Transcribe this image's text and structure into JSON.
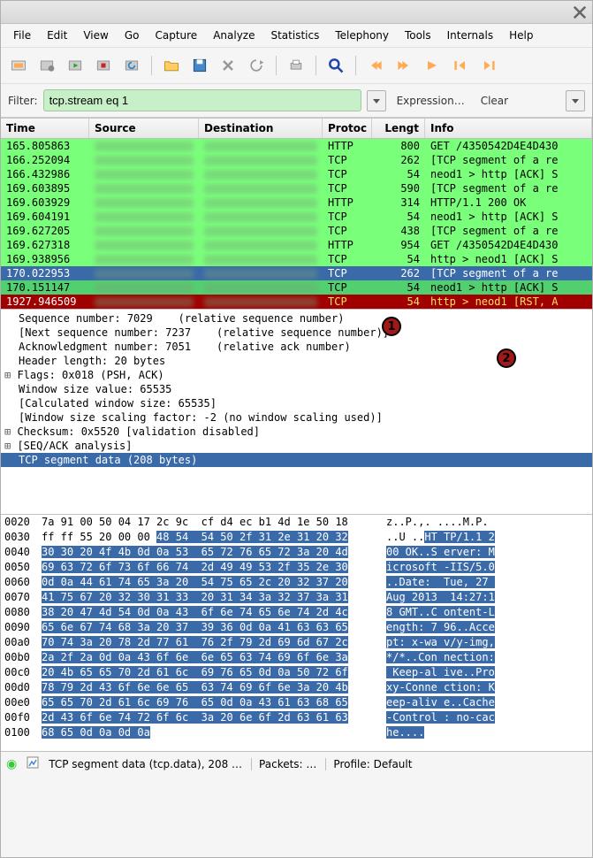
{
  "menus": [
    "File",
    "Edit",
    "View",
    "Go",
    "Capture",
    "Analyze",
    "Statistics",
    "Telephony",
    "Tools",
    "Internals",
    "Help"
  ],
  "filter": {
    "label": "Filter:",
    "value": "tcp.stream eq 1",
    "expr": "Expression…",
    "clear": "Clear"
  },
  "columns": {
    "time": "Time",
    "src": "Source",
    "dst": "Destination",
    "proto": "Protoc",
    "len": "Lengt",
    "info": "Info"
  },
  "packets": [
    {
      "time": "165.805863",
      "proto": "HTTP",
      "len": "800",
      "info": "GET /4350542D4E4D430",
      "cls": "bg-green"
    },
    {
      "time": "166.252094",
      "proto": "TCP",
      "len": "262",
      "info": "[TCP segment of a re",
      "cls": "bg-green"
    },
    {
      "time": "166.432986",
      "proto": "TCP",
      "len": "54",
      "info": "neod1 > http [ACK] S",
      "cls": "bg-green"
    },
    {
      "time": "169.603895",
      "proto": "TCP",
      "len": "590",
      "info": "[TCP segment of a re",
      "cls": "bg-green"
    },
    {
      "time": "169.603929",
      "proto": "HTTP",
      "len": "314",
      "info": "HTTP/1.1 200 OK",
      "cls": "bg-green"
    },
    {
      "time": "169.604191",
      "proto": "TCP",
      "len": "54",
      "info": "neod1 > http [ACK] S",
      "cls": "bg-green"
    },
    {
      "time": "169.627205",
      "proto": "TCP",
      "len": "438",
      "info": "[TCP segment of a re",
      "cls": "bg-green"
    },
    {
      "time": "169.627318",
      "proto": "HTTP",
      "len": "954",
      "info": "GET /4350542D4E4D430",
      "cls": "bg-green"
    },
    {
      "time": "169.938956",
      "proto": "TCP",
      "len": "54",
      "info": "http > neod1 [ACK] S",
      "cls": "bg-green"
    },
    {
      "time": "170.022953",
      "proto": "TCP",
      "len": "262",
      "info": "[TCP segment of a re",
      "cls": "bg-blue"
    },
    {
      "time": "170.151147",
      "proto": "TCP",
      "len": "54",
      "info": "neod1 > http [ACK] S",
      "cls": "bg-darkgreen"
    },
    {
      "time": "1927.946509",
      "proto": "TCP",
      "len": "54",
      "info": "http > neod1 [RST, A",
      "cls": "bg-red"
    }
  ],
  "details": [
    {
      "t": "Sequence number: 7029    (relative sequence number)",
      "exp": false
    },
    {
      "t": "[Next sequence number: 7237    (relative sequence number)]",
      "exp": false
    },
    {
      "t": "Acknowledgment number: 7051    (relative ack number)",
      "exp": false
    },
    {
      "t": "Header length: 20 bytes",
      "exp": false
    },
    {
      "t": "Flags: 0x018 (PSH, ACK)",
      "exp": true
    },
    {
      "t": "Window size value: 65535",
      "exp": false
    },
    {
      "t": "[Calculated window size: 65535]",
      "exp": false
    },
    {
      "t": "[Window size scaling factor: -2 (no window scaling used)]",
      "exp": false
    },
    {
      "t": "Checksum: 0x5520 [validation disabled]",
      "exp": true
    },
    {
      "t": "[SEQ/ACK analysis]",
      "exp": true
    },
    {
      "t": "TCP segment data (208 bytes)",
      "exp": false,
      "sel": true
    }
  ],
  "hex": [
    {
      "off": "0020",
      "b": "7a 91 00 50 04 17 2c 9c  cf d4 ec b1 4d 1e 50 18",
      "a": "z..P.,. ....M.P.",
      "s1": 0,
      "s2": 0
    },
    {
      "off": "0030",
      "b": "ff ff 55 20 00 00 48 54  54 50 2f 31 2e 31 20 32",
      "a": "..U ..HT TP/1.1 2",
      "s1": 6,
      "s2": 6
    },
    {
      "off": "0040",
      "b": "30 30 20 4f 4b 0d 0a 53  65 72 76 65 72 3a 20 4d",
      "a": "00 OK..S erver: M",
      "s1": 0,
      "s2": 0,
      "full": true
    },
    {
      "off": "0050",
      "b": "69 63 72 6f 73 6f 66 74  2d 49 49 53 2f 35 2e 30",
      "a": "icrosoft -IIS/5.0",
      "s1": 0,
      "s2": 0,
      "full": true
    },
    {
      "off": "0060",
      "b": "0d 0a 44 61 74 65 3a 20  54 75 65 2c 20 32 37 20",
      "a": "..Date:  Tue, 27 ",
      "s1": 0,
      "s2": 0,
      "full": true
    },
    {
      "off": "0070",
      "b": "41 75 67 20 32 30 31 33  20 31 34 3a 32 37 3a 31",
      "a": "Aug 2013  14:27:1",
      "s1": 0,
      "s2": 0,
      "full": true
    },
    {
      "off": "0080",
      "b": "38 20 47 4d 54 0d 0a 43  6f 6e 74 65 6e 74 2d 4c",
      "a": "8 GMT..C ontent-L",
      "s1": 0,
      "s2": 0,
      "full": true
    },
    {
      "off": "0090",
      "b": "65 6e 67 74 68 3a 20 37  39 36 0d 0a 41 63 63 65",
      "a": "ength: 7 96..Acce",
      "s1": 0,
      "s2": 0,
      "full": true
    },
    {
      "off": "00a0",
      "b": "70 74 3a 20 78 2d 77 61  76 2f 79 2d 69 6d 67 2c",
      "a": "pt: x-wa v/y-img,",
      "s1": 0,
      "s2": 0,
      "full": true
    },
    {
      "off": "00b0",
      "b": "2a 2f 2a 0d 0a 43 6f 6e  6e 65 63 74 69 6f 6e 3a",
      "a": "*/*..Con nection:",
      "s1": 0,
      "s2": 0,
      "full": true
    },
    {
      "off": "00c0",
      "b": "20 4b 65 65 70 2d 61 6c  69 76 65 0d 0a 50 72 6f",
      "a": " Keep-al ive..Pro",
      "s1": 0,
      "s2": 0,
      "full": true
    },
    {
      "off": "00d0",
      "b": "78 79 2d 43 6f 6e 6e 65  63 74 69 6f 6e 3a 20 4b",
      "a": "xy-Conne ction: K",
      "s1": 0,
      "s2": 0,
      "full": true
    },
    {
      "off": "00e0",
      "b": "65 65 70 2d 61 6c 69 76  65 0d 0a 43 61 63 68 65",
      "a": "eep-aliv e..Cache",
      "s1": 0,
      "s2": 0,
      "full": true
    },
    {
      "off": "00f0",
      "b": "2d 43 6f 6e 74 72 6f 6c  3a 20 6e 6f 2d 63 61 63",
      "a": "-Control : no-cac",
      "s1": 0,
      "s2": 0,
      "full": true
    },
    {
      "off": "0100",
      "b": "68 65 0d 0a 0d 0a",
      "a": "he....",
      "s1": 0,
      "s2": 0,
      "full": true
    }
  ],
  "status": {
    "seg": "TCP segment data (tcp.data), 208 …",
    "pkts": "Packets: …",
    "prof": "Profile: Default"
  }
}
